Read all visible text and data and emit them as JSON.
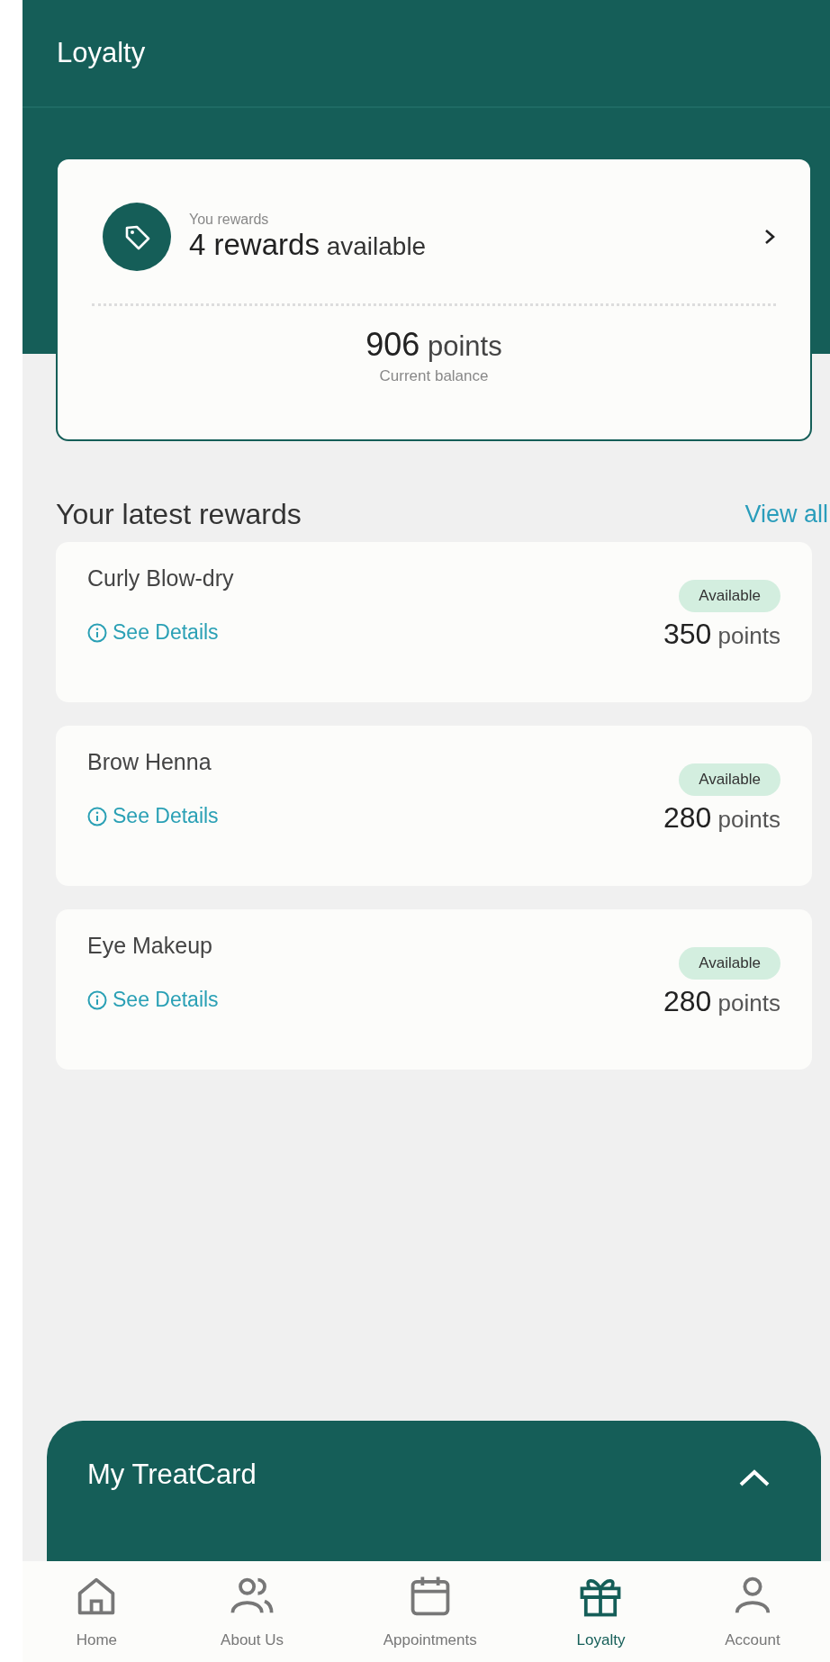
{
  "header": {
    "title": "Loyalty"
  },
  "summary": {
    "caption": "You rewards",
    "rewards": "**4 rewards** available",
    "points": "**906** points",
    "balance_label": "Current balance"
  },
  "latest": {
    "heading": "Your latest rewards",
    "view_all": "View all",
    "rewards": [
      {
        "name": "Curly Blow-dry",
        "details": "See Details",
        "status": "Available",
        "points": "**350** points"
      },
      {
        "name": "Brow Henna",
        "details": "See Details",
        "status": "Available",
        "points": "**280** points"
      },
      {
        "name": "Eye Makeup",
        "details": "See Details",
        "status": "Available",
        "points": "**280** points"
      }
    ]
  },
  "treatcard": {
    "title": "My TreatCard",
    "expanded": true
  },
  "nav": [
    {
      "kind": "home",
      "label": "Home",
      "selected": false
    },
    {
      "kind": "people",
      "label": "About Us",
      "selected": false
    },
    {
      "kind": "calendar",
      "label": "Appointments",
      "selected": false
    },
    {
      "kind": "gift",
      "label": "Loyalty",
      "selected": true
    },
    {
      "kind": "person",
      "label": "Account",
      "selected": false
    }
  ]
}
